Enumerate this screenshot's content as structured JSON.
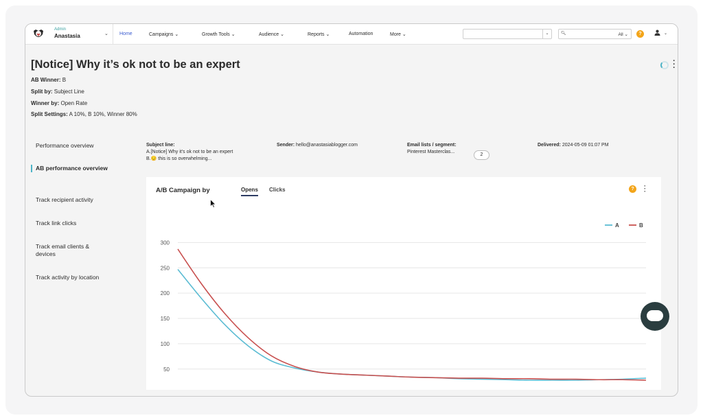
{
  "account": {
    "role": "Admin",
    "name": "Anastasia"
  },
  "nav": [
    {
      "label": "Home",
      "active": true
    },
    {
      "label": "Campaigns",
      "chevron": true
    },
    {
      "label": "Growth Tools",
      "chevron": true
    },
    {
      "label": "Audience",
      "chevron": true
    },
    {
      "label": "Reports",
      "chevron": true
    },
    {
      "label": "Automation"
    },
    {
      "label": "More",
      "chevron": true
    }
  ],
  "search": {
    "value": "",
    "scope": "All"
  },
  "page": {
    "title": "[Notice] Why it’s ok not to be an expert",
    "ab_winner_label": "AB Winner:",
    "ab_winner": "B",
    "split_by_label": "Split by:",
    "split_by": "Subject Line",
    "winner_by_label": "Winner by:",
    "winner_by": "Open Rate",
    "split_settings_label": "Split Settings:",
    "split_settings": "A 10%, B 10%, Winner 80%"
  },
  "sidebar": [
    {
      "label": "Performance overview",
      "active": false
    },
    {
      "label": "AB performance overview",
      "active": true
    },
    {
      "label": "Track recipient activity",
      "active": false
    },
    {
      "label": "Track link clicks",
      "active": false
    },
    {
      "label": "Track email clients & devices",
      "active": false
    },
    {
      "label": "Track activity by location",
      "active": false
    }
  ],
  "summary": {
    "subject_label": "Subject line:",
    "subject_a": "A.[Notice] Why it’s ok not to be an expert",
    "subject_b": "B.😔 this is so overwhelming...",
    "sender_label": "Sender:",
    "sender": "hello@anastasiablogger.com",
    "lists_label": "Email lists / segment:",
    "lists": "Pinterest Masterclas...",
    "lists_more": "2",
    "delivered_label": "Delivered:",
    "delivered": "2024-05-09 01:07 PM"
  },
  "chart_card": {
    "title": "A/B Campaign by",
    "tabs": [
      {
        "label": "Opens",
        "active": true
      },
      {
        "label": "Clicks",
        "active": false
      }
    ]
  },
  "colors": {
    "accent": "#4cb3c6",
    "series_a": "#5bbcd3",
    "series_b": "#c8504f",
    "help": "#f3a51a"
  },
  "chart_data": {
    "type": "line",
    "yticks": [
      300,
      250,
      200,
      150,
      100,
      50
    ],
    "ylim": [
      28,
      310
    ],
    "grid": true,
    "legend_position": "top-right",
    "x": [
      0,
      1,
      2,
      3,
      4,
      5,
      6,
      7,
      8,
      9,
      10,
      11,
      12,
      13,
      14,
      15,
      16,
      17,
      18,
      19,
      20
    ],
    "series": [
      {
        "name": "A",
        "color": "#5bbcd3",
        "values": [
          247,
          190,
          138,
          96,
          66,
          52,
          44,
          40,
          38,
          36,
          34,
          33,
          31,
          30,
          29,
          28,
          28,
          28,
          29,
          30,
          32
        ]
      },
      {
        "name": "B",
        "color": "#c8504f",
        "values": [
          287,
          219,
          160,
          112,
          76,
          55,
          44,
          40,
          38,
          36,
          34,
          33,
          32,
          32,
          31,
          31,
          30,
          30,
          29,
          29,
          28
        ]
      }
    ]
  }
}
